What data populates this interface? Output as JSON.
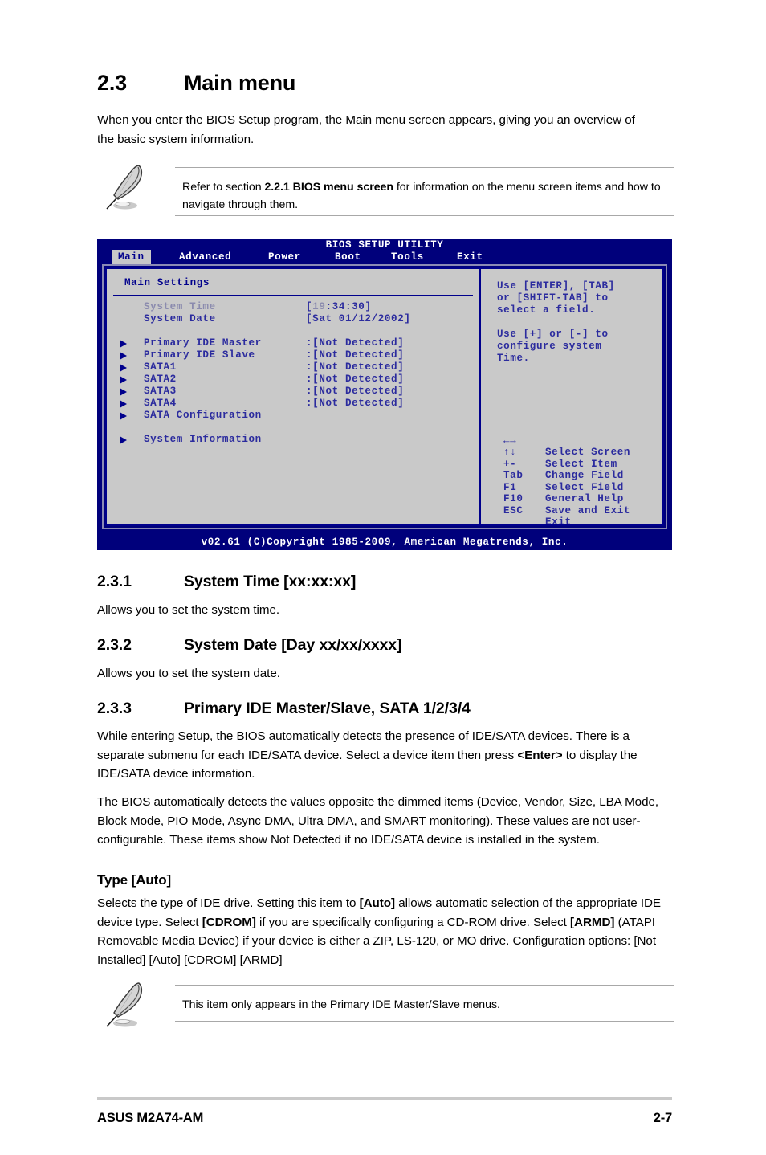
{
  "section": {
    "number": "2.3",
    "title": "Main menu",
    "intro": "When you enter the BIOS Setup program, the Main menu screen appears, giving you an overview of the basic system information."
  },
  "note_top": {
    "icon": "quill-pen-icon",
    "text_before": "Refer to section ",
    "text_bold": "2.2.1 BIOS menu screen",
    "text_after": " for information on the menu screen items and how to navigate through them."
  },
  "bios": {
    "title": "BIOS SETUP UTILITY",
    "tabs": [
      {
        "label": "Main",
        "active": true
      },
      {
        "label": "Advanced",
        "active": false
      },
      {
        "label": "Power",
        "active": false
      },
      {
        "label": "Boot",
        "active": false
      },
      {
        "label": "Tools",
        "active": false
      },
      {
        "label": "Exit",
        "active": false
      }
    ],
    "panel_title": "Main Settings",
    "rows": [
      {
        "label": "System Time",
        "value": "[19:34:30]",
        "arrow": false,
        "dim": true,
        "highlight_value": "19"
      },
      {
        "label": "System Date",
        "value": "[Sat 01/12/2002]",
        "arrow": false,
        "dim": false
      },
      {
        "spacer": true
      },
      {
        "label": "Primary IDE Master",
        "value": ":[Not Detected]",
        "arrow": true,
        "dim": false
      },
      {
        "label": "Primary IDE Slave",
        "value": ":[Not Detected]",
        "arrow": true,
        "dim": false
      },
      {
        "label": "SATA1",
        "value": ":[Not Detected]",
        "arrow": true,
        "dim": false
      },
      {
        "label": "SATA2",
        "value": ":[Not Detected]",
        "arrow": true,
        "dim": false
      },
      {
        "label": "SATA3",
        "value": ":[Not Detected]",
        "arrow": true,
        "dim": false
      },
      {
        "label": "SATA4",
        "value": ":[Not Detected]",
        "arrow": true,
        "dim": false
      },
      {
        "label": "SATA Configuration",
        "value": "",
        "arrow": true,
        "dim": false
      },
      {
        "spacer": true
      },
      {
        "label": "System Information",
        "value": "",
        "arrow": true,
        "dim": false
      }
    ],
    "help_text": "Use [ENTER], [TAB]\nor [SHIFT-TAB] to\nselect a field.\n\nUse [+] or [-] to\nconfigure system\nTime.",
    "keys": [
      {
        "key": "←→",
        "desc": "Select Screen"
      },
      {
        "key": "↑↓",
        "desc": "Select Item"
      },
      {
        "key": "+-",
        "desc": "Change Field"
      },
      {
        "key": "Tab",
        "desc": "Select Field"
      },
      {
        "key": "F1",
        "desc": "General Help"
      },
      {
        "key": "F10",
        "desc": "Save and Exit"
      },
      {
        "key": "ESC",
        "desc": "Exit"
      }
    ],
    "footer": "v02.61 (C)Copyright 1985-2009, American Megatrends, Inc.",
    "colors": {
      "screen_bg": "#00007b",
      "panel_bg": "#c9c9c9",
      "text": "#2b2b9e",
      "dim_text": "#8b8bae",
      "tab_active_bg": "#c9c9c9"
    }
  },
  "sub_231": {
    "number": "2.3.1",
    "title": "System Time [xx:xx:xx]",
    "body": "Allows you to set the system time."
  },
  "sub_232": {
    "number": "2.3.2",
    "title": "System Date [Day xx/xx/xxxx]",
    "body": "Allows you to set the system date."
  },
  "sub_233": {
    "number": "2.3.3",
    "title": "Primary IDE Master/Slave, SATA 1/2/3/4",
    "para1_a": "While entering Setup, the BIOS automatically detects the presence of IDE/SATA devices. There is a separate submenu for each IDE/SATA device. Select a device item then press ",
    "para1_b": "<Enter>",
    "para1_c": " to display the IDE/SATA device information.",
    "para2": "The BIOS automatically detects the values opposite the dimmed items (Device, Vendor, Size, LBA Mode, Block Mode, PIO Mode, Async DMA, Ultra DMA, and SMART monitoring). These values are not user-configurable. These items show Not Detected if no IDE/SATA device is installed in the system."
  },
  "type_auto": {
    "heading": "Type [Auto]",
    "p_a": "Selects the type of IDE drive. Setting this item to ",
    "p_b": "[Auto]",
    "p_c": " allows automatic selection of the appropriate IDE device type. Select ",
    "p_d": "[CDROM]",
    "p_e": " if you are specifically configuring a CD-ROM drive. Select ",
    "p_f": "[ARMD]",
    "p_g": " (ATAPI Removable Media Device) if your device is either a ZIP, LS-120, or MO drive. Configuration options: [Not Installed] [Auto] [CDROM] [ARMD]"
  },
  "note_bottom": {
    "icon": "quill-pen-icon",
    "text": "This item only appears in the Primary IDE Master/Slave menus."
  },
  "footer": {
    "left": "ASUS M2A74-AM",
    "right": "2-7"
  }
}
